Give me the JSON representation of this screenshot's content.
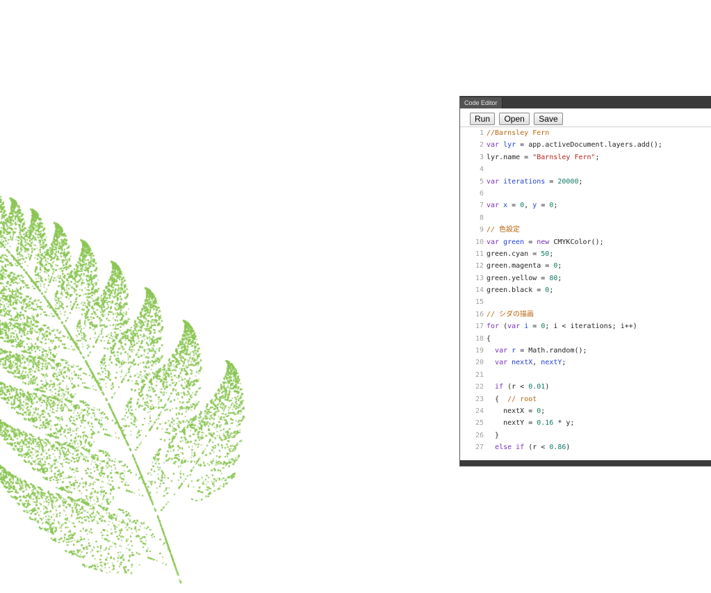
{
  "panel": {
    "title": "Code Editor"
  },
  "toolbar": {
    "run_label": "Run",
    "open_label": "Open",
    "save_label": "Save"
  },
  "colors": {
    "fern": "#8cc657",
    "panel_frame": "#3a3a3a",
    "keyword": "#7a2fbf",
    "variable": "#1f3fd6",
    "number": "#117a65",
    "string": "#b5271a",
    "comment": "#b8650f"
  },
  "code_lines": [
    {
      "n": "1",
      "tokens": [
        [
          "cmt",
          "//Barnsley Fern"
        ]
      ]
    },
    {
      "n": "2",
      "tokens": [
        [
          "kw",
          "var "
        ],
        [
          "var",
          "lyr"
        ],
        [
          "txt",
          " = app.activeDocument.layers.add();"
        ]
      ]
    },
    {
      "n": "3",
      "tokens": [
        [
          "txt",
          "lyr.name = "
        ],
        [
          "str",
          "\"Barnsley Fern\""
        ],
        [
          "txt",
          ";"
        ]
      ]
    },
    {
      "n": "4",
      "tokens": []
    },
    {
      "n": "5",
      "tokens": [
        [
          "kw",
          "var "
        ],
        [
          "var",
          "iterations"
        ],
        [
          "txt",
          " = "
        ],
        [
          "num",
          "20000"
        ],
        [
          "txt",
          ";"
        ]
      ]
    },
    {
      "n": "6",
      "tokens": []
    },
    {
      "n": "7",
      "tokens": [
        [
          "kw",
          "var "
        ],
        [
          "var",
          "x"
        ],
        [
          "txt",
          " = "
        ],
        [
          "num",
          "0"
        ],
        [
          "txt",
          ", "
        ],
        [
          "var",
          "y"
        ],
        [
          "txt",
          " = "
        ],
        [
          "num",
          "0"
        ],
        [
          "txt",
          ";"
        ]
      ]
    },
    {
      "n": "8",
      "tokens": []
    },
    {
      "n": "9",
      "tokens": [
        [
          "cmt",
          "// 色設定"
        ]
      ]
    },
    {
      "n": "10",
      "tokens": [
        [
          "kw",
          "var "
        ],
        [
          "var",
          "green"
        ],
        [
          "txt",
          " = "
        ],
        [
          "kw",
          "new "
        ],
        [
          "txt",
          "CMYKColor();"
        ]
      ]
    },
    {
      "n": "11",
      "tokens": [
        [
          "txt",
          "green.cyan = "
        ],
        [
          "num",
          "50"
        ],
        [
          "txt",
          ";"
        ]
      ]
    },
    {
      "n": "12",
      "tokens": [
        [
          "txt",
          "green.magenta = "
        ],
        [
          "num",
          "0"
        ],
        [
          "txt",
          ";"
        ]
      ]
    },
    {
      "n": "13",
      "tokens": [
        [
          "txt",
          "green.yellow = "
        ],
        [
          "num",
          "80"
        ],
        [
          "txt",
          ";"
        ]
      ]
    },
    {
      "n": "14",
      "tokens": [
        [
          "txt",
          "green.black = "
        ],
        [
          "num",
          "0"
        ],
        [
          "txt",
          ";"
        ]
      ]
    },
    {
      "n": "15",
      "tokens": []
    },
    {
      "n": "16",
      "tokens": [
        [
          "cmt",
          "// シダの描画"
        ]
      ]
    },
    {
      "n": "17",
      "tokens": [
        [
          "kw",
          "for "
        ],
        [
          "txt",
          "("
        ],
        [
          "kw",
          "var "
        ],
        [
          "var",
          "i"
        ],
        [
          "txt",
          " = "
        ],
        [
          "num",
          "0"
        ],
        [
          "txt",
          "; i < iterations; i++)"
        ]
      ]
    },
    {
      "n": "18",
      "tokens": [
        [
          "txt",
          "{"
        ]
      ]
    },
    {
      "n": "19",
      "tokens": [
        [
          "txt",
          "  "
        ],
        [
          "kw",
          "var "
        ],
        [
          "var",
          "r"
        ],
        [
          "txt",
          " = Math.random();"
        ]
      ]
    },
    {
      "n": "20",
      "tokens": [
        [
          "txt",
          "  "
        ],
        [
          "kw",
          "var "
        ],
        [
          "var",
          "nextX"
        ],
        [
          "txt",
          ", "
        ],
        [
          "var",
          "nextY"
        ],
        [
          "txt",
          ";"
        ]
      ]
    },
    {
      "n": "21",
      "tokens": []
    },
    {
      "n": "22",
      "tokens": [
        [
          "txt",
          "  "
        ],
        [
          "kw",
          "if "
        ],
        [
          "txt",
          "(r < "
        ],
        [
          "num",
          "0.01"
        ],
        [
          "txt",
          ")"
        ]
      ]
    },
    {
      "n": "23",
      "tokens": [
        [
          "txt",
          "  {  "
        ],
        [
          "cmt",
          "// root"
        ]
      ]
    },
    {
      "n": "24",
      "tokens": [
        [
          "txt",
          "    nextX = "
        ],
        [
          "num",
          "0"
        ],
        [
          "txt",
          ";"
        ]
      ]
    },
    {
      "n": "25",
      "tokens": [
        [
          "txt",
          "    nextY = "
        ],
        [
          "num",
          "0.16"
        ],
        [
          "txt",
          " * y;"
        ]
      ]
    },
    {
      "n": "26",
      "tokens": [
        [
          "txt",
          "  }"
        ]
      ]
    },
    {
      "n": "27",
      "tokens": [
        [
          "txt",
          "  "
        ],
        [
          "kw",
          "else if "
        ],
        [
          "txt",
          "(r < "
        ],
        [
          "num",
          "0.86"
        ],
        [
          "txt",
          ")"
        ]
      ]
    }
  ]
}
